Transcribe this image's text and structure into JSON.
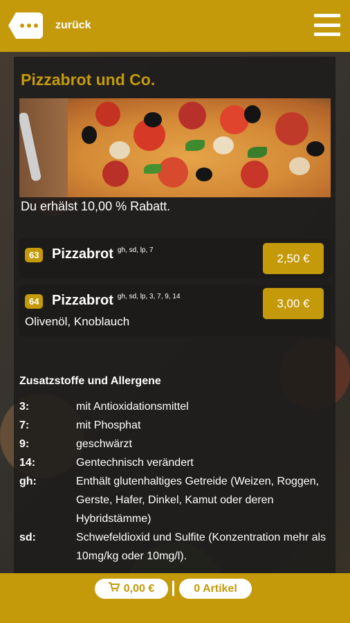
{
  "header": {
    "back_label": "zurück"
  },
  "category": {
    "title": "Pizzabrot und Co.",
    "discount_text": "Du erhälst 10,00 % Rabatt."
  },
  "products": [
    {
      "number": "63",
      "name": "Pizzabrot",
      "allergens": "gh, sd, lp, 7",
      "description": "",
      "price": "2,50 €"
    },
    {
      "number": "64",
      "name": "Pizzabrot",
      "allergens": "gh, sd, lp, 3, 7, 9, 14",
      "description": "Olivenöl, Knoblauch",
      "price": "3,00 €"
    }
  ],
  "additives": {
    "heading": "Zusatzstoffe und Allergene",
    "rows": [
      {
        "key": "3:",
        "value": "mit Antioxidationsmittel"
      },
      {
        "key": "7:",
        "value": "mit Phosphat"
      },
      {
        "key": "9:",
        "value": "geschwärzt"
      },
      {
        "key": "14:",
        "value": "Gentechnisch verändert"
      },
      {
        "key": "gh:",
        "value": "Enthält glutenhaltiges Getreide (Weizen, Roggen, Gerste, Hafer, Dinkel, Kamut oder deren Hybridstämme)"
      },
      {
        "key": "sd:",
        "value": "Schwefeldioxid und Sulfite (Konzentration mehr als 10mg/kg oder 10mg/l)."
      }
    ]
  },
  "footer": {
    "cart_total": "0,00 €",
    "item_count": "0 Artikel"
  },
  "colors": {
    "accent": "#c49a0a",
    "panel": "#1e1d1b"
  }
}
